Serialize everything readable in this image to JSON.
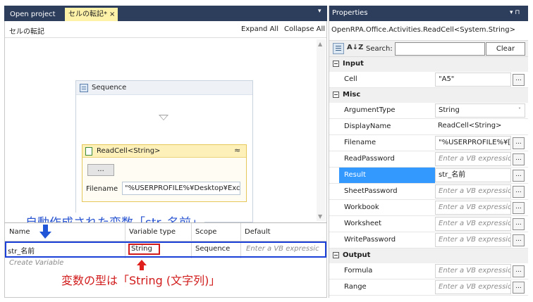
{
  "tabs": {
    "open_project": "Open project",
    "active": "セルの転記*",
    "close_glyph": "×",
    "dropdown_glyph": "▾"
  },
  "designer": {
    "breadcrumb": "セルの転記",
    "expand_all": "Expand All",
    "collapse_all": "Collapse All",
    "sequence": {
      "title": "Sequence"
    },
    "activity": {
      "title": "ReadCell<String>",
      "dots_label": "...",
      "filename_label": "Filename",
      "filename_value": "\"%USERPROFILE%¥Desktop¥Exc"
    }
  },
  "annotations": {
    "auto_variable": "自動作成された変数「str_名前」",
    "variable_type": "変数の型は「String (文字列)」"
  },
  "variables": {
    "headers": {
      "name": "Name",
      "type": "Variable type",
      "scope": "Scope",
      "default": "Default"
    },
    "row": {
      "name": "str_名前",
      "type": "String",
      "scope": "Sequence",
      "default_placeholder": "Enter a VB expressic"
    },
    "create_variable": "Create Variable"
  },
  "properties": {
    "title": "Properties",
    "title_controls": "▾ ⊓",
    "type_name": "OpenRPA.Office.Activities.ReadCell<System.String>",
    "search_label": "Search:",
    "search_value": "",
    "clear_label": "Clear",
    "sort_glyph": "A↓Z",
    "categories": {
      "input": "Input",
      "misc": "Misc",
      "output": "Output"
    },
    "rows": {
      "cell": {
        "name": "Cell",
        "value": "\"A5\""
      },
      "argument_type": {
        "name": "ArgumentType",
        "value": "String"
      },
      "display_name": {
        "name": "DisplayName",
        "value": "ReadCell<String>"
      },
      "filename": {
        "name": "Filename",
        "value": "\"%USERPROFILE%¥["
      },
      "read_password": {
        "name": "ReadPassword",
        "value": "Enter a VB expressio"
      },
      "result": {
        "name": "Result",
        "value": "str_名前"
      },
      "sheet_password": {
        "name": "SheetPassword",
        "value": "Enter a VB expressio"
      },
      "workbook": {
        "name": "Workbook",
        "value": "Enter a VB expressio"
      },
      "worksheet": {
        "name": "Worksheet",
        "value": "Enter a VB expressio"
      },
      "write_password": {
        "name": "WritePassword",
        "value": "Enter a VB expressio"
      },
      "formula": {
        "name": "Formula",
        "value": "Enter a VB expressio"
      },
      "range": {
        "name": "Range",
        "value": "Enter a VB expressio"
      }
    },
    "ellipsis": "..."
  },
  "colors": {
    "title_bar": "#2d3e5c",
    "active_tab": "#fef1a8",
    "selection": "#3399ff",
    "annotation_blue": "#2a55d1",
    "annotation_red": "#d11b1b"
  }
}
